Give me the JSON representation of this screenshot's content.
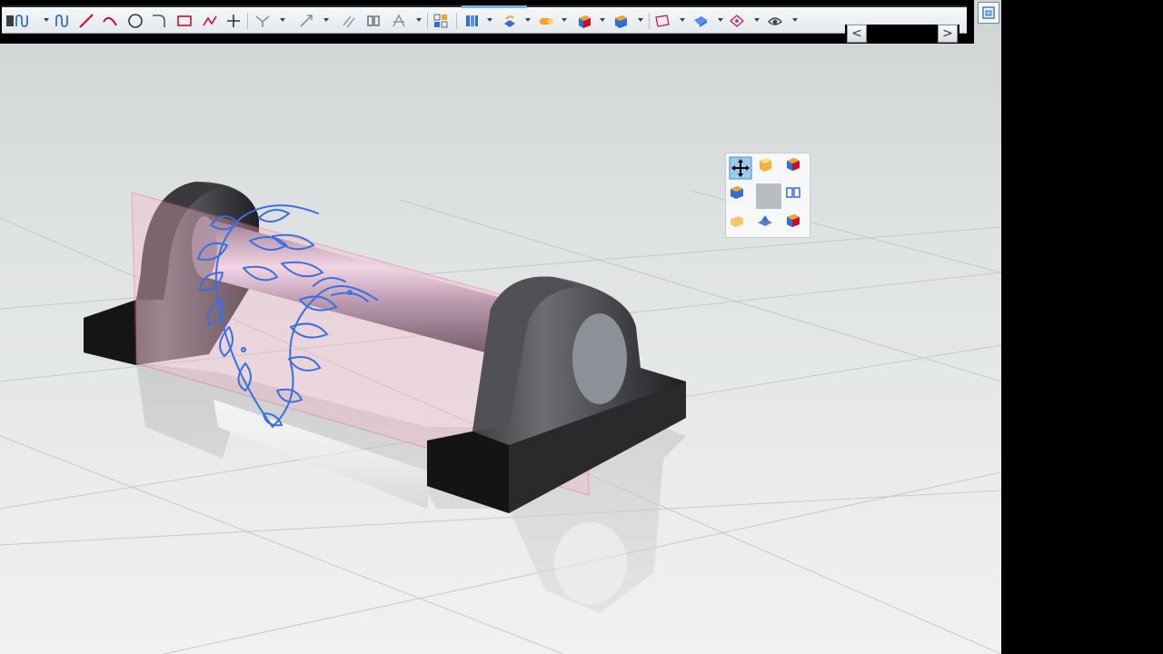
{
  "app": {
    "title": "",
    "colors": {
      "toolbar_bg": "#eef2f6",
      "icon_red": "#c8102e",
      "icon_blue": "#2f6fd6",
      "icon_orange": "#f2a225",
      "sketch_stroke": "#3b6fe0",
      "datum_plane": "#f48fb1",
      "part_dark": "#2c2c2e"
    }
  },
  "toolbar": {
    "tools": [
      {
        "name": "studio-spline-icon"
      },
      {
        "name": "studio-spline-2-icon"
      },
      {
        "name": "line-icon"
      },
      {
        "name": "arc-icon"
      },
      {
        "name": "circle-icon"
      },
      {
        "name": "fillet-icon"
      },
      {
        "name": "rectangle-icon"
      },
      {
        "name": "polyline-icon"
      },
      {
        "name": "point-icon"
      },
      {
        "name": "quick-trim-icon"
      },
      {
        "name": "quick-extend-icon"
      },
      {
        "name": "offset-curve-icon"
      },
      {
        "name": "mirror-curve-icon"
      },
      {
        "name": "pattern-curve-icon"
      },
      {
        "name": "layout-icon"
      },
      {
        "name": "extrude-icon"
      },
      {
        "name": "revolve-icon"
      },
      {
        "name": "cylinder-icon"
      },
      {
        "name": "block-icon"
      },
      {
        "name": "view-cube-icon"
      },
      {
        "name": "datum-plane-icon"
      },
      {
        "name": "sweep-icon"
      },
      {
        "name": "surface-icon"
      },
      {
        "name": "render-icon"
      }
    ],
    "scroll_left_glyph": "<",
    "scroll_right_glyph": ">"
  },
  "view_palette": {
    "cells": [
      {
        "name": "view-top-left-icon",
        "active": true
      },
      {
        "name": "view-top-icon"
      },
      {
        "name": "view-isometric-icon"
      },
      {
        "name": "view-left-icon"
      },
      {
        "name": "view-center"
      },
      {
        "name": "view-right-icon"
      },
      {
        "name": "view-bottom-left-icon"
      },
      {
        "name": "view-bottom-icon"
      },
      {
        "name": "view-trimetric-icon"
      }
    ]
  },
  "viewport": {
    "model": "pillow-block-with-shaft",
    "sketch": "laurel-branch-sketch",
    "datum": "datum-plane",
    "floor": "reflective-grid-floor"
  }
}
